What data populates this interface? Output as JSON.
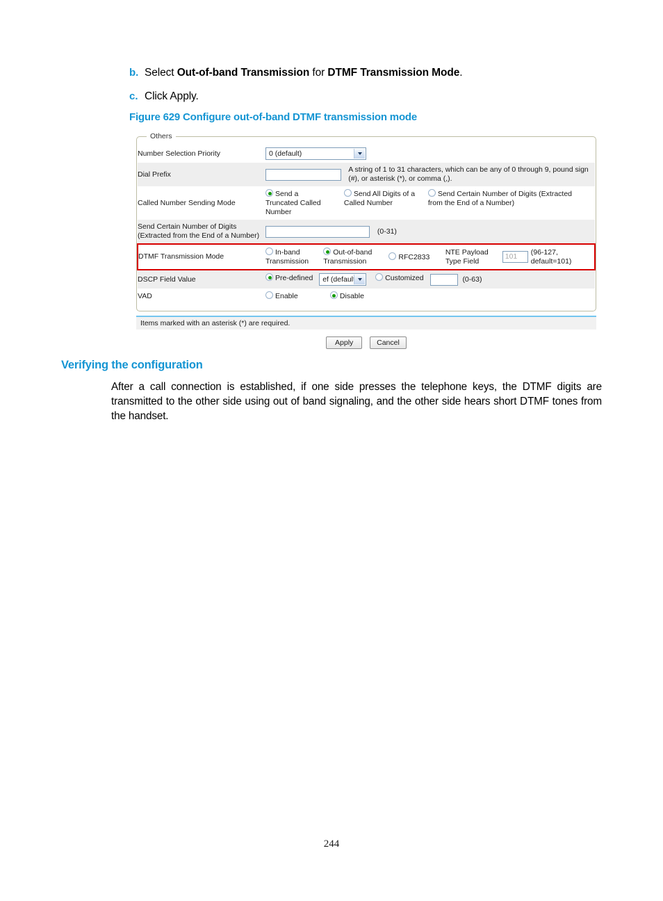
{
  "document": {
    "page_number": "244",
    "steps": [
      {
        "marker": "b.",
        "text_html": "Select <b>Out-of-band Transmission</b> for <b>DTMF Transmission Mode</b>."
      },
      {
        "marker": "c.",
        "text_html": "Click Apply."
      }
    ],
    "figure_caption": "Figure 629 Configure out-of-band DTMF transmission mode",
    "section_heading": "Verifying the configuration",
    "body_paragraph": "After a call connection is established, if one side presses the telephone keys, the DTMF digits are transmitted to the other side using out of band signaling, and the other side hears short DTMF tones from the handset."
  },
  "screenshot": {
    "fieldset_legend": "Others",
    "rows": {
      "number_selection_priority": {
        "label": "Number Selection Priority",
        "select_value": "0 (default)"
      },
      "dial_prefix": {
        "label": "Dial Prefix",
        "input_value": "",
        "hint": "A string of 1 to 31 characters, which can be any of 0 through 9, pound sign (#), or asterisk (*), or comma (,)."
      },
      "called_number_sending_mode": {
        "label": "Called Number Sending Mode",
        "options": [
          {
            "label": "Send a Truncated Called Number",
            "selected": true
          },
          {
            "label": "Send All Digits of a Called Number",
            "selected": false
          },
          {
            "label": "Send Certain Number of Digits (Extracted from the End of a Number)",
            "selected": false
          }
        ]
      },
      "send_certain_number_of_digits": {
        "label": "Send Certain Number of Digits (Extracted from the End of a Number)",
        "input_value": "",
        "range": "(0-31)"
      },
      "dtmf_transmission_mode": {
        "label": "DTMF Transmission Mode",
        "highlighted": true,
        "options": [
          {
            "label": "In-band Transmission",
            "selected": false
          },
          {
            "label": "Out-of-band Transmission",
            "selected": true
          },
          {
            "label": "RFC2833",
            "selected": false
          }
        ],
        "nte_label": "NTE Payload Type Field",
        "nte_value": "101",
        "nte_range": "(96-127, default=101)"
      },
      "dscp_field_value": {
        "label": "DSCP Field Value",
        "predefined_label": "Pre-defined",
        "predefined_selected": true,
        "predefined_select_value": "ef (default",
        "customized_label": "Customized",
        "customized_selected": false,
        "customized_value": "",
        "range": "(0-63)"
      },
      "vad": {
        "label": "VAD",
        "options": [
          {
            "label": "Enable",
            "selected": false
          },
          {
            "label": "Disable",
            "selected": true
          }
        ]
      }
    },
    "required_note": "Items marked with an asterisk (*) are required.",
    "buttons": {
      "apply": "Apply",
      "cancel": "Cancel"
    }
  },
  "colors": {
    "heading_blue": "#1595D3",
    "highlight_red": "#d80000",
    "radio_green": "#159c0c",
    "row_alt_gray": "#eeeeee",
    "fieldset_border": "#bdbda4"
  }
}
